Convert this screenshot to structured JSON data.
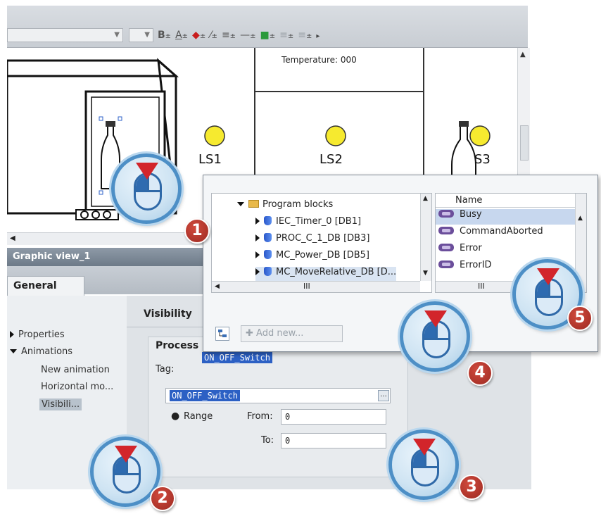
{
  "toolbar": {
    "bold": "B",
    "font_color": "A",
    "fill": "◆",
    "line_color": "⁄",
    "align": "≡",
    "line_style": "—",
    "fill_pattern": "■",
    "drop": "±",
    "more": "▸"
  },
  "canvas": {
    "temperature_label": "Temperature: 000",
    "lamps": [
      "LS1",
      "LS2",
      "S3"
    ],
    "lamp_color": "#f6ea2f"
  },
  "panel": {
    "title": "Graphic view_1",
    "tab_general": "General",
    "section_visibility": "Visibility",
    "section_process": "Process",
    "nav": {
      "properties": "Properties",
      "animations": "Animations",
      "new_animation": "New animation",
      "horizontal": "Horizontal mo...",
      "visibility": "Visibili..."
    },
    "tag_label": "Tag:",
    "tag_highlight": "ON_OFF_Switch",
    "tag_field_value": "ON_OFF_Switch",
    "browse_button": "...",
    "range_label": "Range",
    "from_label": "From:",
    "from_value": "0",
    "to_label": "To:",
    "to_value": "0"
  },
  "popup": {
    "tree": {
      "root": "Program blocks",
      "items": [
        "IEC_Timer_0 [DB1]",
        "PROC_C_1_DB [DB3]",
        "MC_Power_DB [DB5]",
        "MC_MoveRelative_DB [D..."
      ],
      "hscroll_mark": "III"
    },
    "list": {
      "header": "Name",
      "items": [
        "Busy",
        "CommandAborted",
        "Error",
        "ErrorID"
      ],
      "hscroll_mark": "III"
    },
    "add_new": "Add new..."
  },
  "callouts": [
    "1",
    "2",
    "3",
    "4",
    "5"
  ]
}
